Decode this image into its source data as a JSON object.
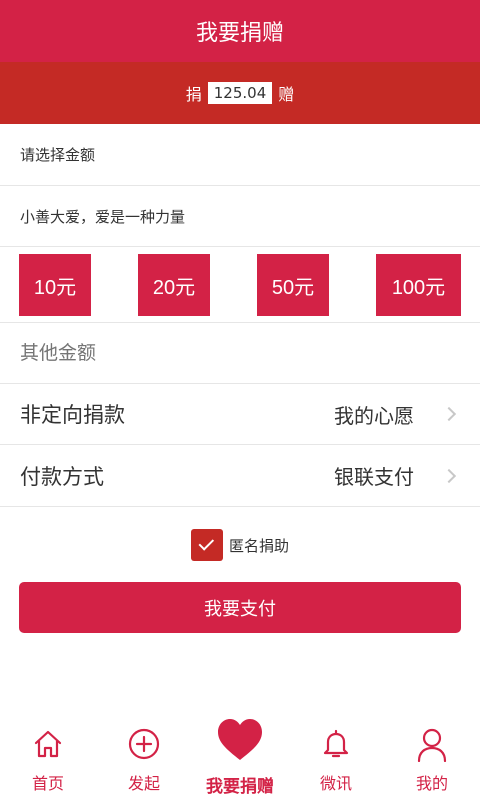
{
  "header": {
    "title": "我要捐赠"
  },
  "amount_bar": {
    "prefix": "捐",
    "amount": "125.04",
    "suffix": "赠"
  },
  "select_prompt": "请选择金额",
  "slogan": "小善大爱，爱是一种力量",
  "amount_options": [
    "10元",
    "20元",
    "50元",
    "100元"
  ],
  "other_amount": {
    "placeholder": "其他金额"
  },
  "donation_type": {
    "label": "非定向捐款",
    "value": "我的心愿"
  },
  "payment_method": {
    "label": "付款方式",
    "value": "银联支付"
  },
  "anonymous": {
    "label": "匿名捐助",
    "checked": true
  },
  "pay_button": "我要支付",
  "tabs": [
    {
      "label": "首页",
      "icon": "home-icon"
    },
    {
      "label": "发起",
      "icon": "plus-circle-icon"
    },
    {
      "label": "我要捐赠",
      "icon": "heart-icon"
    },
    {
      "label": "微讯",
      "icon": "bell-icon"
    },
    {
      "label": "我的",
      "icon": "user-icon"
    }
  ],
  "colors": {
    "primary": "#d32246",
    "amount_bar": "#c42a25"
  }
}
